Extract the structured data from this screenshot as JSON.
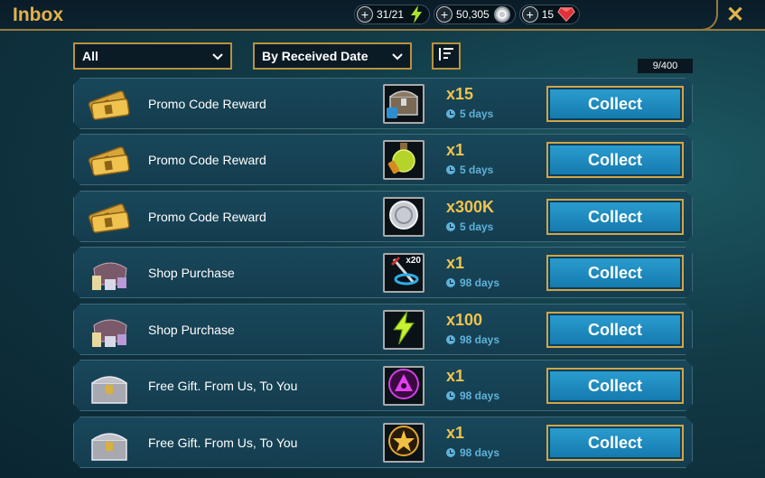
{
  "header": {
    "title": "Inbox",
    "resources": [
      {
        "value": "31/21",
        "icon": "energy-icon"
      },
      {
        "value": "50,305",
        "icon": "silver-coin-icon"
      },
      {
        "value": "15",
        "icon": "ruby-icon"
      }
    ],
    "close_label": "✕"
  },
  "filters": {
    "category": "All",
    "sort": "By Received Date",
    "counter": "9/400"
  },
  "rows": [
    {
      "label": "Promo Code Reward",
      "qty": "x15",
      "days": "5 days",
      "icon": "ticket-icon",
      "reward_icon": "chest-icon",
      "button": "Collect"
    },
    {
      "label": "Promo Code Reward",
      "qty": "x1",
      "days": "5 days",
      "icon": "ticket-icon",
      "reward_icon": "potion-icon",
      "button": "Collect"
    },
    {
      "label": "Promo Code Reward",
      "qty": "x300K",
      "days": "5 days",
      "icon": "ticket-icon",
      "reward_icon": "silver-coin-icon",
      "button": "Collect"
    },
    {
      "label": "Shop Purchase",
      "qty": "x1",
      "days": "98 days",
      "icon": "shop-bag-icon",
      "reward_icon": "sword-ring-icon",
      "reward_badge": "x20",
      "button": "Collect"
    },
    {
      "label": "Shop Purchase",
      "qty": "x100",
      "days": "98 days",
      "icon": "shop-bag-icon",
      "reward_icon": "energy-icon",
      "button": "Collect"
    },
    {
      "label": "Free Gift. From Us, To You",
      "qty": "x1",
      "days": "98 days",
      "icon": "gift-chest-icon",
      "reward_icon": "void-shard-icon",
      "button": "Collect"
    },
    {
      "label": "Free Gift. From Us, To You",
      "qty": "x1",
      "days": "98 days",
      "icon": "gift-chest-icon",
      "reward_icon": "star-medal-icon",
      "button": "Collect"
    }
  ]
}
